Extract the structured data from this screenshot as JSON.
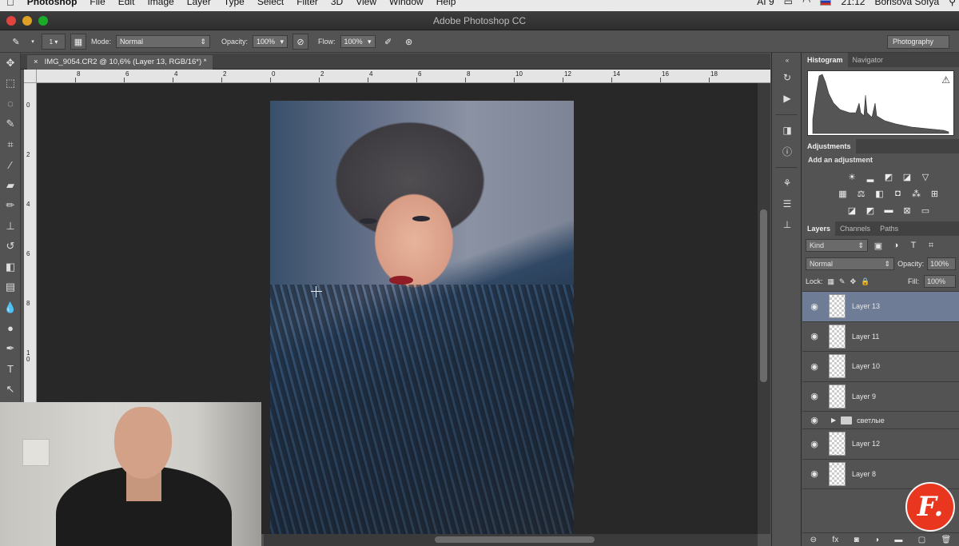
{
  "menubar": {
    "app_name": "Photoshop",
    "menus": [
      "File",
      "Edit",
      "Image",
      "Layer",
      "Type",
      "Select",
      "Filter",
      "3D",
      "View",
      "Window",
      "Help"
    ],
    "status_ai": "AI 9",
    "clock": "21:12",
    "user": "Borisova Sofya"
  },
  "window": {
    "title": "Adobe Photoshop CC"
  },
  "options": {
    "brush_size": "1",
    "mode_label": "Mode:",
    "mode_value": "Normal",
    "opacity_label": "Opacity:",
    "opacity_value": "100%",
    "flow_label": "Flow:",
    "flow_value": "100%",
    "workspace": "Photography"
  },
  "document": {
    "tab_close": "×",
    "tab_title": "IMG_9054.CR2 @ 10,6% (Layer 13, RGB/16*) *"
  },
  "ruler_top_labels": [
    "8",
    "6",
    "4",
    "2",
    "0",
    "2",
    "4",
    "6",
    "8",
    "10",
    "12",
    "14",
    "16",
    "18"
  ],
  "ruler_left_labels": [
    "0",
    "2",
    "4",
    "6",
    "8",
    "10"
  ],
  "panels": {
    "tab_histogram": "Histogram",
    "tab_navigator": "Navigator",
    "tab_adjustments": "Adjustments",
    "add_adjustment": "Add an adjustment",
    "tab_layers": "Layers",
    "tab_channels": "Channels",
    "tab_paths": "Paths",
    "kind_label": "Kind",
    "blend_mode": "Normal",
    "opacity_label": "Opacity:",
    "opacity_value": "100%",
    "lock_label": "Lock:",
    "fill_label": "Fill:",
    "fill_value": "100%"
  },
  "layers": [
    {
      "name": "Layer 13",
      "selected": true
    },
    {
      "name": "Layer 11"
    },
    {
      "name": "Layer 10"
    },
    {
      "name": "Layer 9"
    },
    {
      "name": "светлые",
      "group": true
    },
    {
      "name": "Layer 12"
    },
    {
      "name": "Layer 8"
    }
  ],
  "brand_badge": "F."
}
